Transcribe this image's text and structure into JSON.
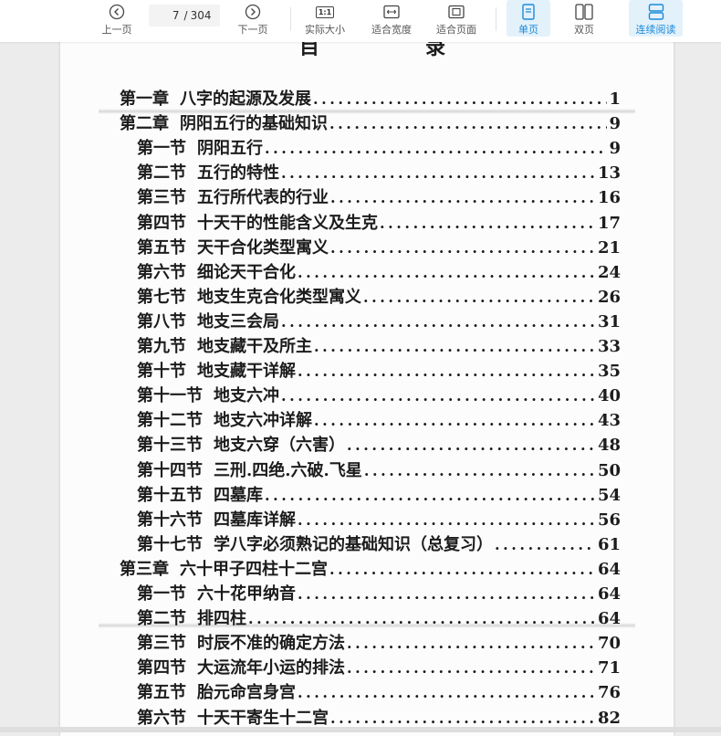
{
  "toolbar": {
    "prev_label": "上一页",
    "next_label": "下一页",
    "current_page": "7",
    "total_pages": "304",
    "actual_size_label": "实际大小",
    "actual_size_icon_text": "1:1",
    "fit_width_label": "适合宽度",
    "fit_page_label": "适合页面",
    "single_page_label": "单页",
    "double_page_label": "双页",
    "continuous_label": "连续阅读",
    "accent_color": "#1b8ad9"
  },
  "document": {
    "heading_left": "目",
    "heading_right": "录",
    "entries": [
      {
        "label": "第一章",
        "title": "八字的起源及发展",
        "page": "1",
        "level": 0
      },
      {
        "label": "第二章",
        "title": "阴阳五行的基础知识",
        "page": "9",
        "level": 0
      },
      {
        "label": "第一节",
        "title": "阴阳五行",
        "page": "9",
        "level": 1
      },
      {
        "label": "第二节",
        "title": "五行的特性",
        "page": "13",
        "level": 1
      },
      {
        "label": "第三节",
        "title": "五行所代表的行业",
        "page": "16",
        "level": 1
      },
      {
        "label": "第四节",
        "title": "十天干的性能含义及生克",
        "page": "17",
        "level": 1
      },
      {
        "label": "第五节",
        "title": "天干合化类型寓义",
        "page": "21",
        "level": 1
      },
      {
        "label": "第六节",
        "title": "细论天干合化",
        "page": "24",
        "level": 1
      },
      {
        "label": "第七节",
        "title": "地支生克合化类型寓义",
        "page": "26",
        "level": 1
      },
      {
        "label": "第八节",
        "title": "地支三会局",
        "page": "31",
        "level": 1
      },
      {
        "label": "第九节",
        "title": "地支藏干及所主",
        "page": "33",
        "level": 1
      },
      {
        "label": "第十节",
        "title": "地支藏干详解",
        "page": "35",
        "level": 1
      },
      {
        "label": "第十一节",
        "title": "地支六冲",
        "page": "40",
        "level": 1
      },
      {
        "label": "第十二节",
        "title": "地支六冲详解",
        "page": "43",
        "level": 1
      },
      {
        "label": "第十三节",
        "title": "地支六穿（六害）",
        "page": "48",
        "level": 1
      },
      {
        "label": "第十四节",
        "title": "三刑.四绝.六破.飞星",
        "page": "50",
        "level": 1
      },
      {
        "label": "第十五节",
        "title": "四墓库",
        "page": "54",
        "level": 1
      },
      {
        "label": "第十六节",
        "title": "四墓库详解",
        "page": "56",
        "level": 1
      },
      {
        "label": "第十七节",
        "title": "学八字必须熟记的基础知识（总复习）",
        "page": "61",
        "level": 1
      },
      {
        "label": "第三章",
        "title": "六十甲子四柱十二宫",
        "page": "64",
        "level": 0
      },
      {
        "label": "第一节",
        "title": "六十花甲纳音",
        "page": "64",
        "level": 1
      },
      {
        "label": "第二节",
        "title": "排四柱",
        "page": "64",
        "level": 1
      },
      {
        "label": "第三节",
        "title": "时辰不准的确定方法",
        "page": "70",
        "level": 1
      },
      {
        "label": "第四节",
        "title": "大运流年小运的排法",
        "page": "71",
        "level": 1
      },
      {
        "label": "第五节",
        "title": "胎元命宫身宫",
        "page": "76",
        "level": 1
      },
      {
        "label": "第六节",
        "title": "十天干寄生十二宫",
        "page": "82",
        "level": 1
      }
    ]
  }
}
